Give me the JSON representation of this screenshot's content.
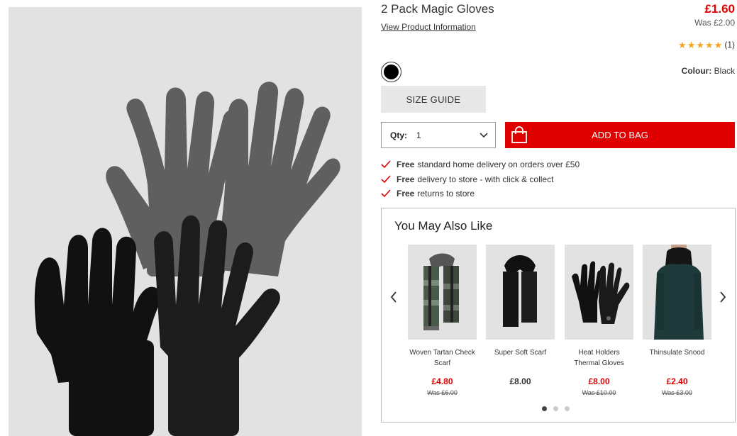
{
  "product": {
    "title": "2 Pack Magic Gloves",
    "view_info": "View Product Information",
    "price": "£1.60",
    "was_price": "Was £2.00",
    "rating_stars": 5,
    "rating_count": "(1)",
    "colour_label": "Colour:",
    "colour_value": "Black",
    "swatch_color": "#000000",
    "image_icon": "gloves-photo"
  },
  "actions": {
    "size_guide": "SIZE GUIDE",
    "qty_label": "Qty:",
    "qty_value": "1",
    "add_to_bag": "ADD TO BAG"
  },
  "benefits": [
    {
      "strong": "Free",
      "text": "standard home delivery on orders over £50"
    },
    {
      "strong": "Free",
      "text": "delivery to store - with click & collect"
    },
    {
      "strong": "Free",
      "text": "returns to store"
    }
  ],
  "recommendations": {
    "title": "You May Also Like",
    "items": [
      {
        "name": "Woven Tartan Check Scarf",
        "price": "£4.80",
        "was": "Was £6.00",
        "sale": true
      },
      {
        "name": "Super Soft Scarf",
        "price": "£8.00",
        "was": "",
        "sale": false
      },
      {
        "name": "Heat Holders Thermal Gloves",
        "price": "£8.00",
        "was": "Was £10.00",
        "sale": true
      },
      {
        "name": "Thinsulate Snood",
        "price": "£2.40",
        "was": "Was £3.00",
        "sale": true
      }
    ],
    "active_page": 1,
    "pages": 3
  },
  "colors": {
    "accent_red": "#e00000",
    "star": "#f5a623",
    "image_bg": "#e2e2e2"
  }
}
